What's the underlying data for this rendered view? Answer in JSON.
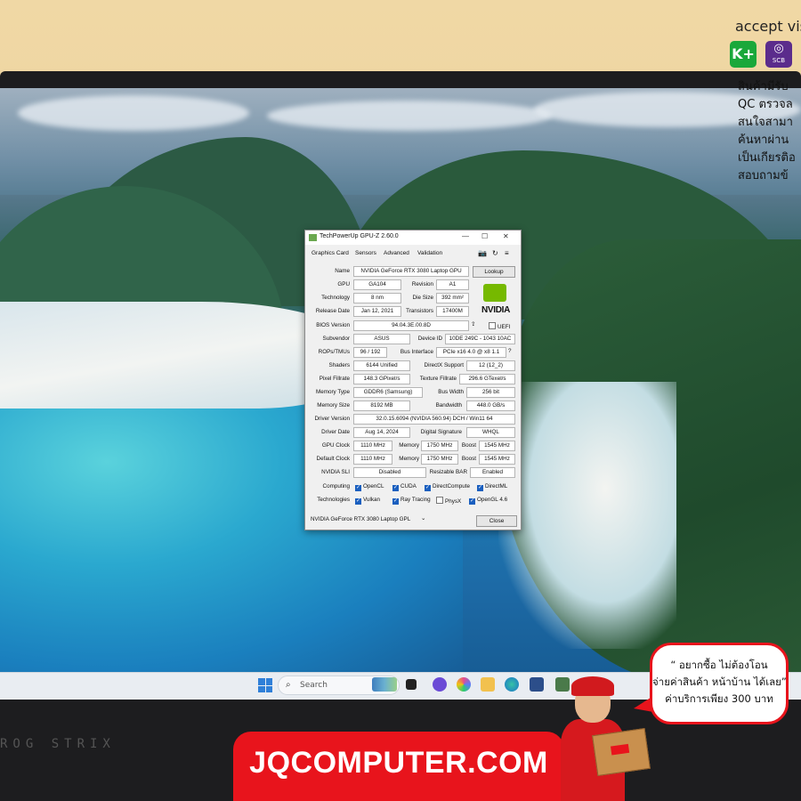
{
  "overlay": {
    "accept_text": "accept vis",
    "payment_badges": [
      {
        "label": "K+",
        "color": "#1aa83a",
        "icon": "kplus-icon"
      },
      {
        "label": "SCB",
        "color": "#5b2c8c",
        "icon": "scb-icon"
      }
    ],
    "bullets": [
      "สินค้ามีรับ",
      "QC ตรวจล",
      "สนใจสามา",
      "ค้นหาผ่าน",
      "เป็นเกียรติอ",
      "สอบถามข้"
    ]
  },
  "taskbar": {
    "search_placeholder": "Search"
  },
  "gpuz": {
    "title": "TechPowerUp GPU-Z 2.60.0",
    "tabs": [
      "Graphics Card",
      "Sensors",
      "Advanced",
      "Validation"
    ],
    "lookup_label": "Lookup",
    "uefi_label": "UEFI",
    "help_glyph": "?",
    "nvidia_logo_text": "NVIDIA",
    "rows": {
      "name": {
        "label": "Name",
        "value": "NVIDIA GeForce RTX 3080 Laptop GPU"
      },
      "gpu": {
        "label": "GPU",
        "value": "GA104"
      },
      "revision": {
        "label": "Revision",
        "value": "A1"
      },
      "technology": {
        "label": "Technology",
        "value": "8 nm"
      },
      "die_size": {
        "label": "Die Size",
        "value": "392 mm²"
      },
      "release_date": {
        "label": "Release Date",
        "value": "Jan 12, 2021"
      },
      "transistors": {
        "label": "Transistors",
        "value": "17400M"
      },
      "bios_version": {
        "label": "BIOS Version",
        "value": "94.04.3E.00.8D"
      },
      "subvendor": {
        "label": "Subvendor",
        "value": "ASUS"
      },
      "device_id": {
        "label": "Device ID",
        "value": "10DE 249C - 1043 10AC"
      },
      "rops": {
        "label": "ROPs/TMUs",
        "value": "96 / 192"
      },
      "bus_interface": {
        "label": "Bus Interface",
        "value": "PCIe x16 4.0 @ x8 1.1"
      },
      "shaders": {
        "label": "Shaders",
        "value": "6144 Unified"
      },
      "directx": {
        "label": "DirectX Support",
        "value": "12 (12_2)"
      },
      "pixel_fillrate": {
        "label": "Pixel Fillrate",
        "value": "148.3 GPixel/s"
      },
      "texture_fillrate": {
        "label": "Texture Fillrate",
        "value": "296.6 GTexel/s"
      },
      "memory_type": {
        "label": "Memory Type",
        "value": "GDDR6 (Samsung)"
      },
      "bus_width": {
        "label": "Bus Width",
        "value": "256 bit"
      },
      "memory_size": {
        "label": "Memory Size",
        "value": "8192 MB"
      },
      "bandwidth": {
        "label": "Bandwidth",
        "value": "448.0 GB/s"
      },
      "driver_version": {
        "label": "Driver Version",
        "value": "32.0.15.6094 (NVIDIA 560.94) DCH / Win11 64"
      },
      "driver_date": {
        "label": "Driver Date",
        "value": "Aug 14, 2024"
      },
      "digital_signature": {
        "label": "Digital Signature",
        "value": "WHQL"
      },
      "gpu_clock": {
        "label": "GPU Clock",
        "value": "1110 MHz",
        "memory_label": "Memory",
        "memory": "1750 MHz",
        "boost_label": "Boost",
        "boost": "1545 MHz"
      },
      "default_clock": {
        "label": "Default Clock",
        "value": "1110 MHz",
        "memory_label": "Memory",
        "memory": "1750 MHz",
        "boost_label": "Boost",
        "boost": "1545 MHz"
      },
      "nvidia_sli": {
        "label": "NVIDIA SLI",
        "value": "Disabled"
      },
      "resizable_bar": {
        "label": "Resizable BAR",
        "value": "Enabled"
      }
    },
    "computing": {
      "label": "Computing",
      "items": [
        "OpenCL",
        "CUDA",
        "DirectCompute",
        "DirectML"
      ]
    },
    "technologies": {
      "label": "Technologies",
      "items": [
        "Vulkan",
        "Ray Tracing",
        "PhysX",
        "OpenGL 4.6"
      ]
    },
    "gpu_select": "NVIDIA GeForce RTX 3080 Laptop GPL",
    "close_label": "Close"
  },
  "bezel": {
    "brand_text": "ROG STRIX"
  },
  "banner": {
    "site": "JQCOMPUTER.COM"
  },
  "bubble": {
    "line1": "“ อยากซื้อ ไม่ต้องโอน",
    "line2": "จ่ายค่าสินค้า หน้าบ้าน ได้เลย”",
    "line3": "ค่าบริการเพียง 300 บาท"
  }
}
